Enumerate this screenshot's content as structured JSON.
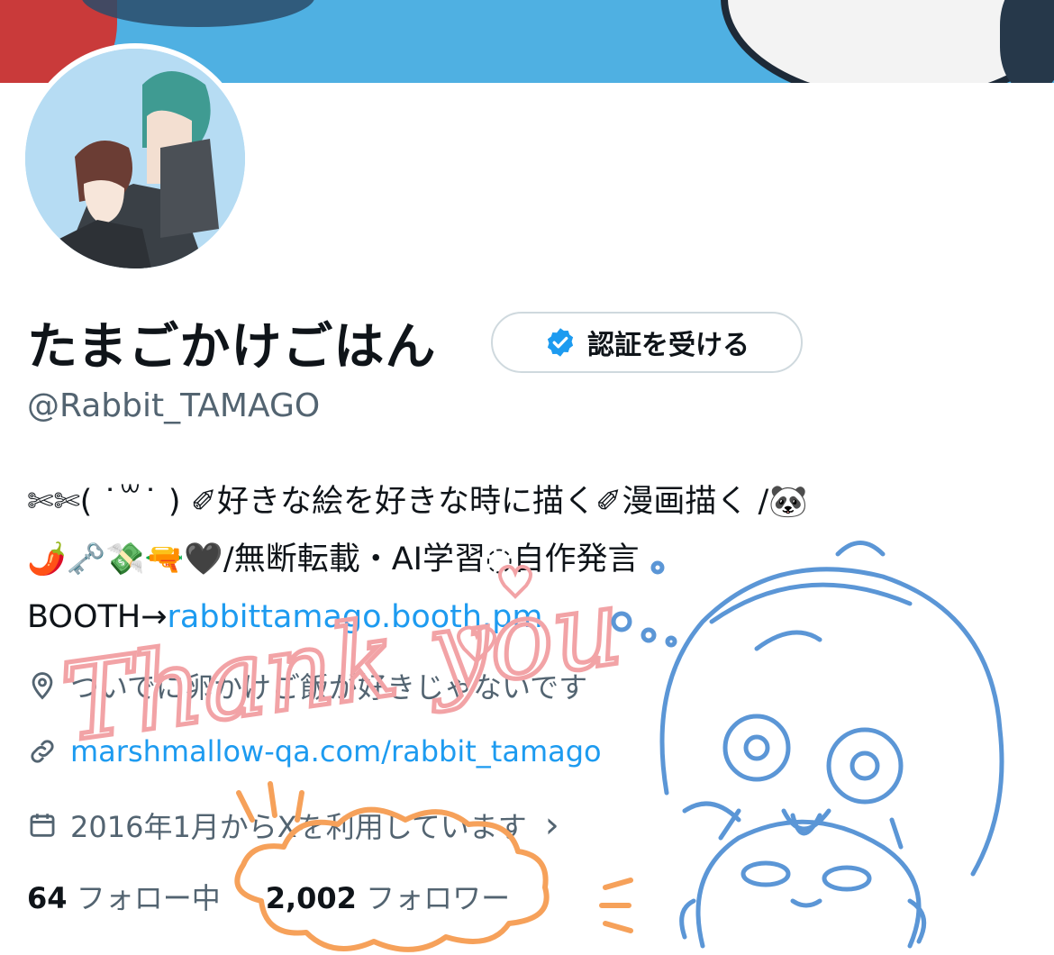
{
  "profile": {
    "display_name": "たまごかけごはん",
    "handle": "@Rabbit_TAMAGO",
    "verify_button_label": "認証を受ける",
    "bio_line1": "✄✄( ˙꒳˙ ) ✐好きな絵を好きな時に描く✐漫画描く /🐼",
    "bio_line2": "🌶️🗝️💸🔫🖤/無断転載・AI学習◌自作発言",
    "bio_line3_prefix": "BOOTH→",
    "bio_line3_link": "rabbittamago.booth.pm",
    "location": "ついでに卵かけご飯が好きじゃないです",
    "website": "marshmallow-qa.com/rabbit_tamago",
    "joined": "2016年1月からXを利用しています",
    "joined_chevron": "›",
    "following_count": "64",
    "following_label": "フォロー中",
    "followers_count": "2,002",
    "followers_label": "フォロワー"
  },
  "icons": {
    "verified": "verified-badge-icon",
    "location": "location-pin-icon",
    "link": "link-icon",
    "calendar": "calendar-icon",
    "chevron": "chevron-right-icon"
  },
  "handwritten": {
    "thank_you": "Thank you"
  },
  "colors": {
    "accent_blue": "#1d9bf0",
    "secondary_text": "#536471",
    "pink_ink": "#f2a3a6",
    "orange_ink": "#f6a15a",
    "sketch_blue": "#5b96d6"
  }
}
